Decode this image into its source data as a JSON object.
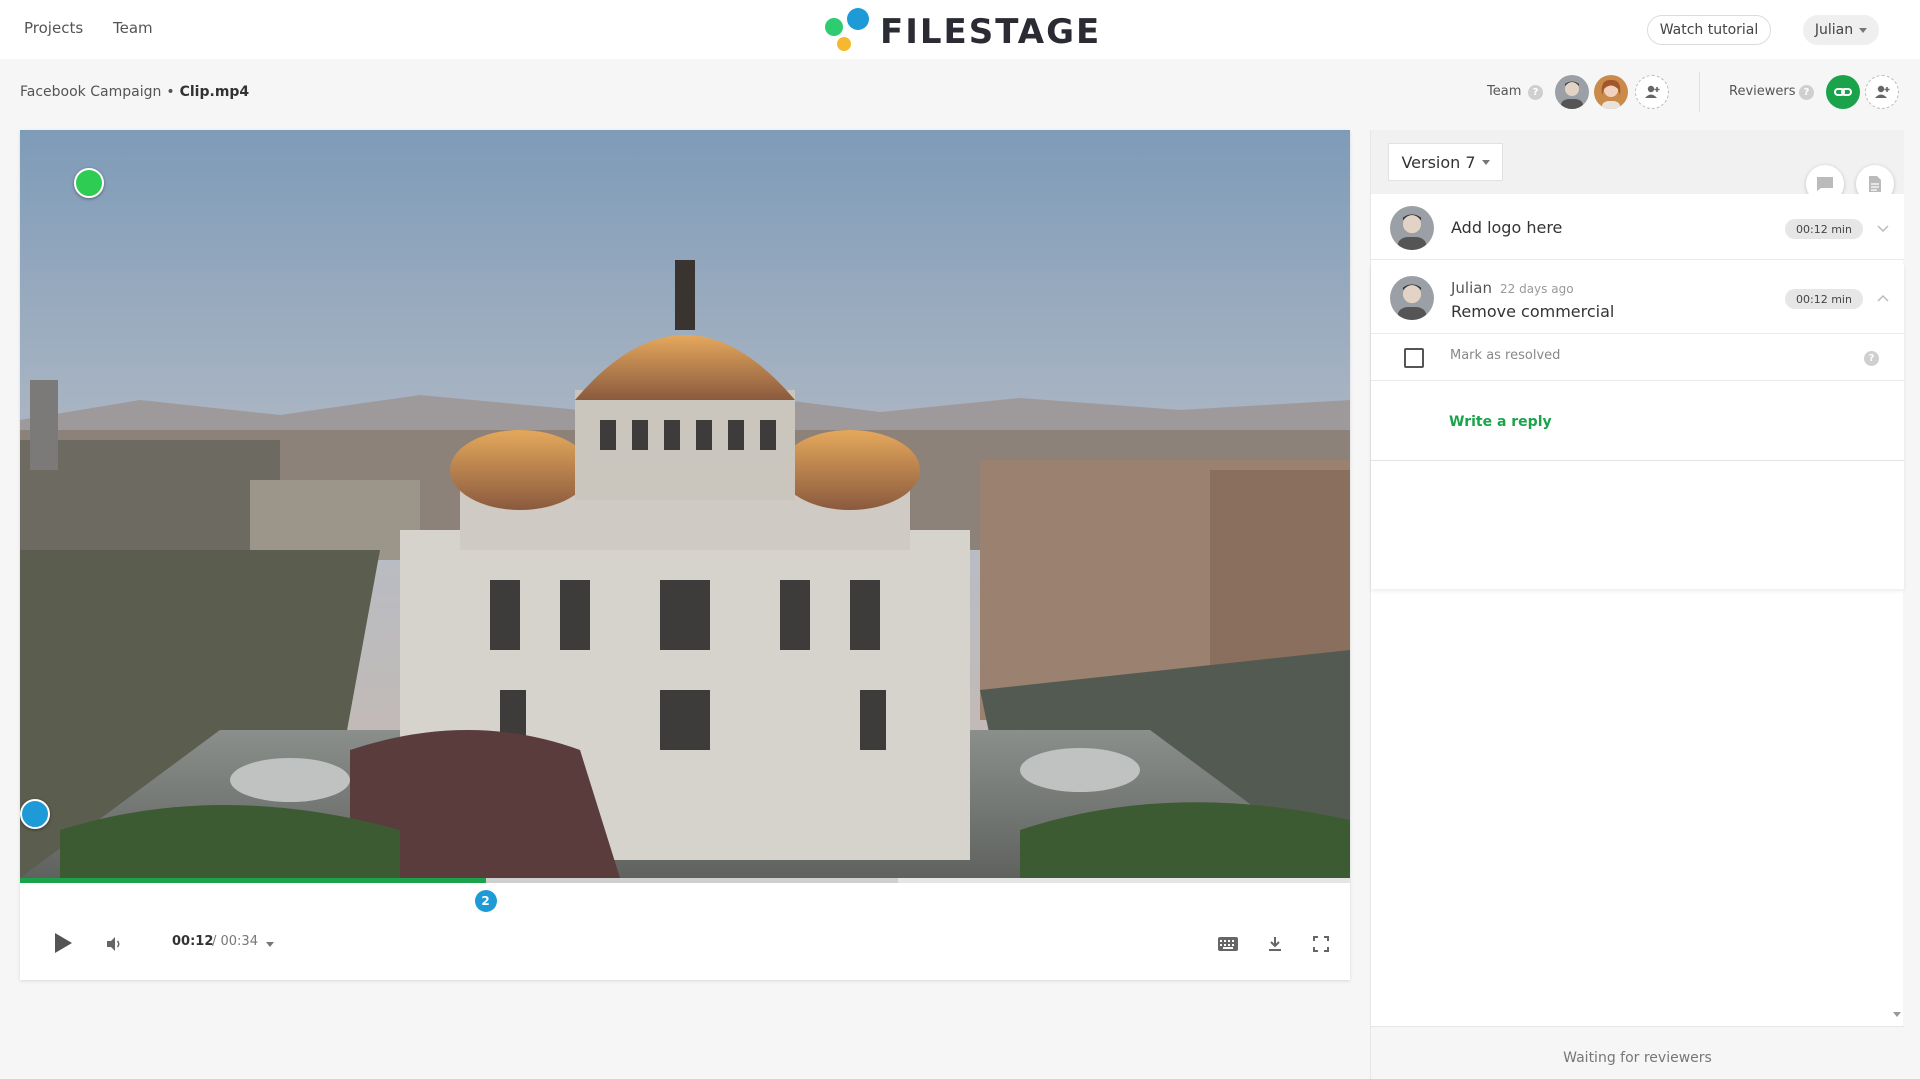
{
  "nav": {
    "projects": "Projects",
    "team": "Team"
  },
  "logo": {
    "text": "FILESTAGE",
    "colors": [
      "#2ecc71",
      "#1e9bd7",
      "#f5b82e"
    ]
  },
  "header_right": {
    "watch_tutorial": "Watch tutorial",
    "user": "Julian"
  },
  "breadcrumb": {
    "project": "Facebook Campaign",
    "separator": "•",
    "file": "Clip.mp4"
  },
  "collaborators": {
    "team_label": "Team",
    "reviewers_label": "Reviewers",
    "help_glyph": "?"
  },
  "player": {
    "current_time": "00:12",
    "total_time": "/ 00:34",
    "progress": 0.35,
    "buffered": 0.66,
    "comment_pin_label": "2",
    "icons": [
      "play-icon",
      "volume-icon",
      "keyboard-icon",
      "download-icon",
      "fullscreen-icon"
    ]
  },
  "panel": {
    "version": "Version 7",
    "comments": [
      {
        "text": "Add logo here",
        "time": "00:12 min"
      },
      {
        "author": "Julian",
        "ago": "22 days ago",
        "text": "Remove commercial",
        "time": "00:12 min",
        "resolve_label": "Mark as resolved",
        "reply_label": "Write a reply"
      }
    ],
    "status": "Waiting for reviewers"
  },
  "colors": {
    "accent_green": "#1aa34a",
    "accent_blue": "#1e9bd7"
  }
}
